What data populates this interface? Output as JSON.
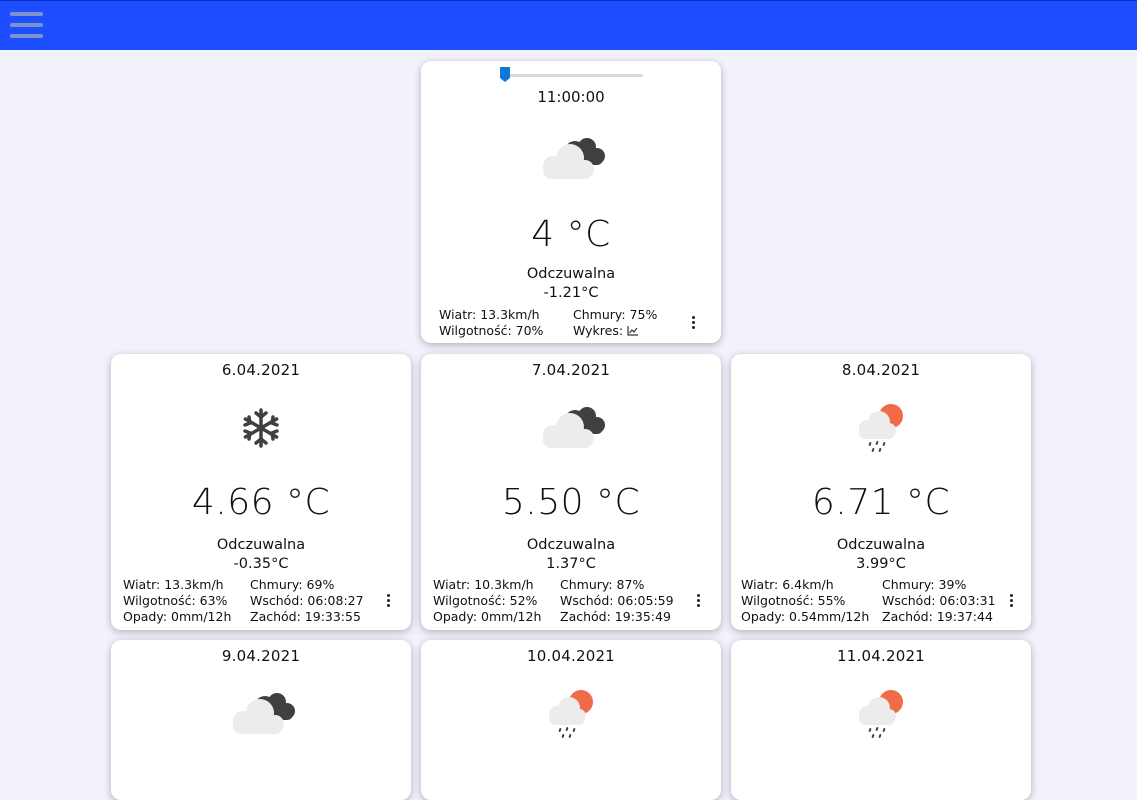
{
  "colors": {
    "topbar": "#1d4eff",
    "accent": "#0f75d6",
    "sun": "#f06b49",
    "cloud_dark": "#404040",
    "cloud_light": "#ececec"
  },
  "header": {
    "menu_icon": "hamburger-menu-icon"
  },
  "current": {
    "time": "11:00:00",
    "time_slider_fraction": 0.04,
    "icon": "cloudy-icon",
    "temp": "4 °C",
    "feel_label": "Odczuwalna",
    "feel_value": "-1.21°C",
    "wind": "Wiatr: 13.3km/h",
    "humidity": "Wilgotność: 70%",
    "clouds": "Chmury: 75%",
    "chart_label": "Wykres:",
    "chart_icon": "line-chart-icon"
  },
  "days": [
    {
      "date": "6.04.2021",
      "icon": "snowflake-icon",
      "temp": "4.66 °C",
      "feel_label": "Odczuwalna",
      "feel_value": "-0.35°C",
      "wind": "Wiatr: 13.3km/h",
      "humidity": "Wilgotność: 63%",
      "rain": "Opady: 0mm/12h",
      "clouds": "Chmury: 69%",
      "sunrise": "Wschód: 06:08:27",
      "sunset": "Zachód: 19:33:55"
    },
    {
      "date": "7.04.2021",
      "icon": "cloudy-icon",
      "temp": "5.50 °C",
      "feel_label": "Odczuwalna",
      "feel_value": "1.37°C",
      "wind": "Wiatr: 10.3km/h",
      "humidity": "Wilgotność: 52%",
      "rain": "Opady: 0mm/12h",
      "clouds": "Chmury: 87%",
      "sunrise": "Wschód: 06:05:59",
      "sunset": "Zachód: 19:35:49"
    },
    {
      "date": "8.04.2021",
      "icon": "sun-rain-icon",
      "temp": "6.71 °C",
      "feel_label": "Odczuwalna",
      "feel_value": "3.99°C",
      "wind": "Wiatr: 6.4km/h",
      "humidity": "Wilgotność: 55%",
      "rain": "Opady: 0.54mm/12h",
      "clouds": "Chmury: 39%",
      "sunrise": "Wschód: 06:03:31",
      "sunset": "Zachód: 19:37:44"
    },
    {
      "date": "9.04.2021",
      "icon": "cloudy-icon"
    },
    {
      "date": "10.04.2021",
      "icon": "sun-rain-icon"
    },
    {
      "date": "11.04.2021",
      "icon": "sun-rain-icon"
    }
  ]
}
